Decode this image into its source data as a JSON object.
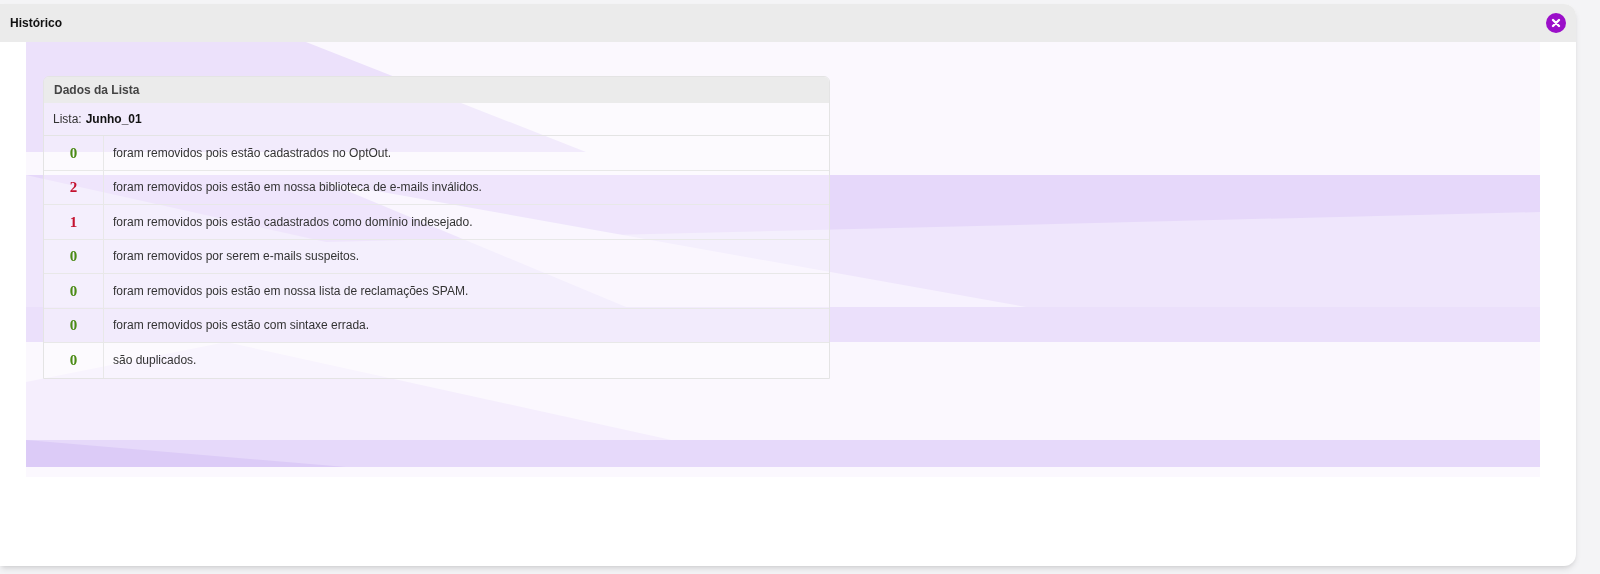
{
  "window": {
    "title": "Histórico"
  },
  "panel": {
    "title": "Dados da Lista",
    "list_label": "Lista:",
    "list_name": "Junho_01"
  },
  "rows": [
    {
      "count": "0",
      "color": "#4b8b16",
      "text": "foram removidos pois estão cadastrados no OptOut."
    },
    {
      "count": "2",
      "color": "#c4122f",
      "text": "foram removidos pois estão em nossa biblioteca de e-mails inválidos."
    },
    {
      "count": "1",
      "color": "#c4122f",
      "text": "foram removidos pois estão cadastrados como domínio indesejado."
    },
    {
      "count": "0",
      "color": "#4b8b16",
      "text": "foram removidos por serem e-mails suspeitos."
    },
    {
      "count": "0",
      "color": "#4b8b16",
      "text": "foram removidos pois estão em nossa lista de reclamações SPAM."
    },
    {
      "count": "0",
      "color": "#4b8b16",
      "text": "foram removidos pois estão com sintaxe errada."
    },
    {
      "count": "0",
      "color": "#4b8b16",
      "text": "são duplicados."
    }
  ]
}
